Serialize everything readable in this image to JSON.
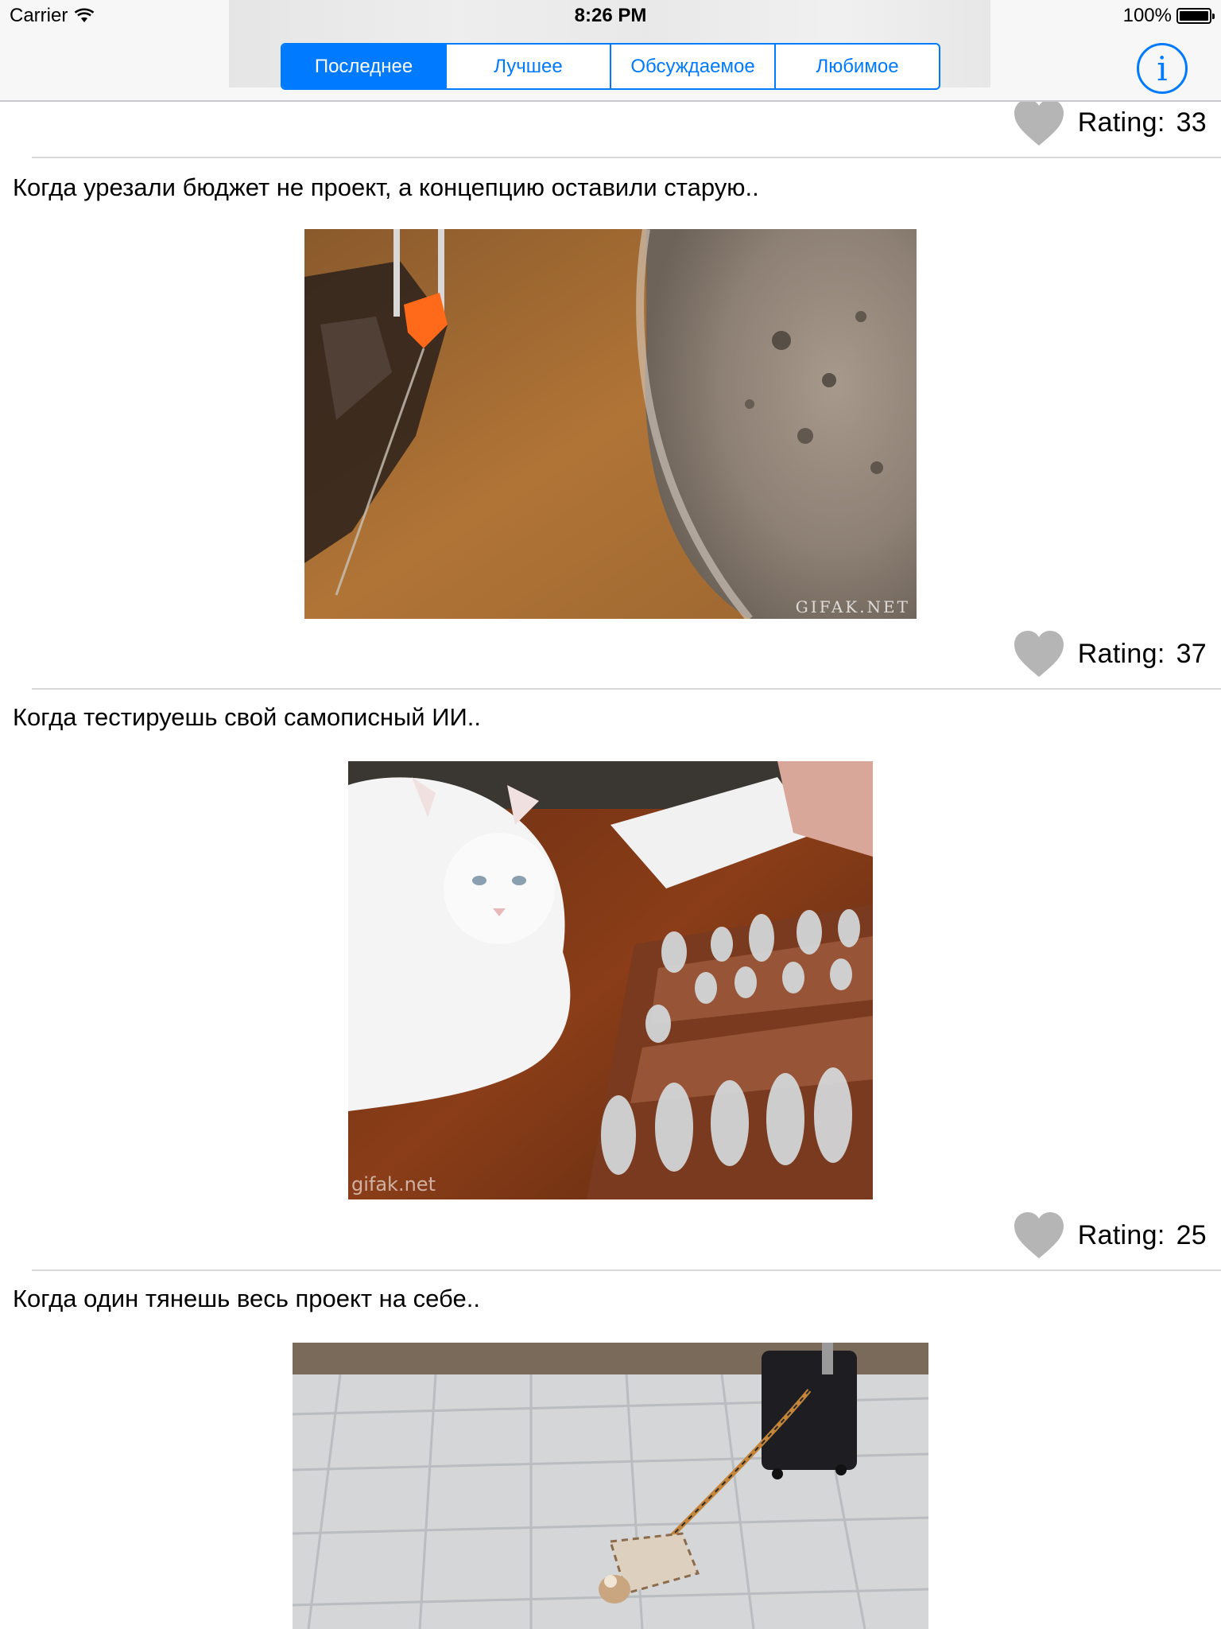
{
  "status_bar": {
    "carrier": "Carrier",
    "time": "8:26 PM",
    "battery": "100%"
  },
  "tabs": [
    {
      "label": "Последнее",
      "selected": true
    },
    {
      "label": "Лучшее",
      "selected": false
    },
    {
      "label": "Обсуждаемое",
      "selected": false
    },
    {
      "label": "Любимое",
      "selected": false
    }
  ],
  "info_button": {
    "icon": "info-icon",
    "glyph": "i"
  },
  "rating_label": "Rating:",
  "posts": [
    {
      "rating": "33"
    },
    {
      "caption": "Когда урезали бюджет не проект, а концепцию оставили старую..",
      "watermark": "GIFAK.NET",
      "rating": "37"
    },
    {
      "caption": "Когда тестируешь свой самописный ИИ..",
      "watermark": "gifak.net",
      "rating": "25"
    },
    {
      "caption": "Когда один тянешь весь проект на себе.."
    }
  ],
  "colors": {
    "accent": "#007aff",
    "heart": "#b5b5b5",
    "separator": "#d9d9d9",
    "bar_background": "#f7f7f7"
  }
}
